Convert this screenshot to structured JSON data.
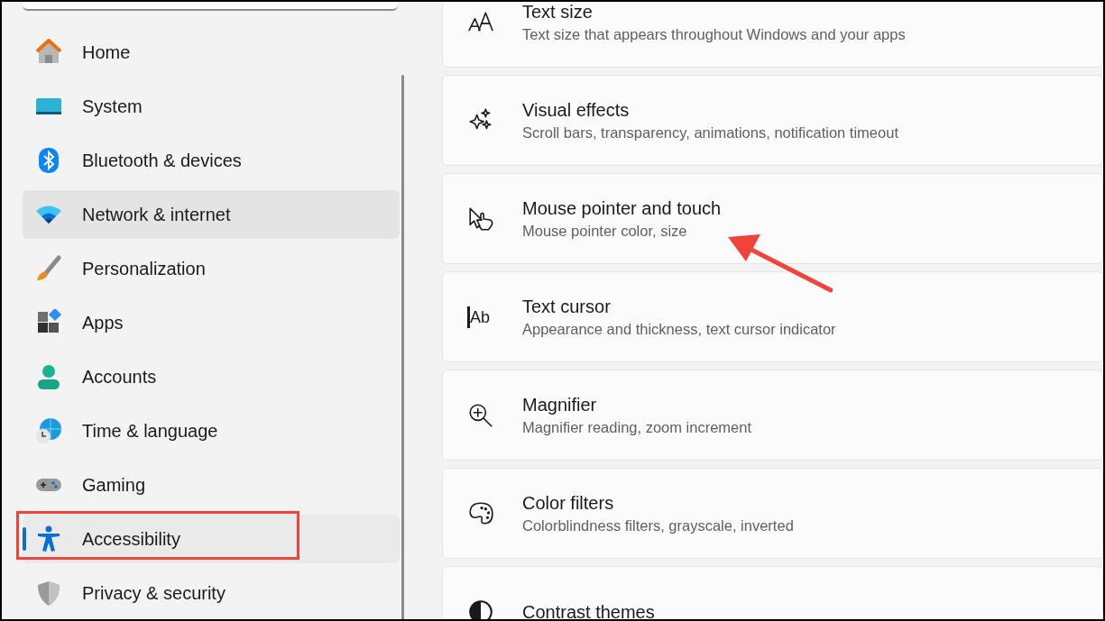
{
  "sidebar": {
    "items": [
      {
        "label": "Home",
        "selected": false,
        "hovered": false,
        "outlined": false
      },
      {
        "label": "System",
        "selected": false,
        "hovered": false,
        "outlined": false
      },
      {
        "label": "Bluetooth & devices",
        "selected": false,
        "hovered": false,
        "outlined": false
      },
      {
        "label": "Network & internet",
        "selected": false,
        "hovered": true,
        "outlined": false
      },
      {
        "label": "Personalization",
        "selected": false,
        "hovered": false,
        "outlined": false
      },
      {
        "label": "Apps",
        "selected": false,
        "hovered": false,
        "outlined": false
      },
      {
        "label": "Accounts",
        "selected": false,
        "hovered": false,
        "outlined": false
      },
      {
        "label": "Time & language",
        "selected": false,
        "hovered": false,
        "outlined": false
      },
      {
        "label": "Gaming",
        "selected": false,
        "hovered": false,
        "outlined": false
      },
      {
        "label": "Accessibility",
        "selected": true,
        "hovered": false,
        "outlined": true
      },
      {
        "label": "Privacy & security",
        "selected": false,
        "hovered": false,
        "outlined": false
      }
    ]
  },
  "settings": [
    {
      "title": "Text size",
      "subtitle": "Text size that appears throughout Windows and your apps",
      "arrow": false
    },
    {
      "title": "Visual effects",
      "subtitle": "Scroll bars, transparency, animations, notification timeout",
      "arrow": false
    },
    {
      "title": "Mouse pointer and touch",
      "subtitle": "Mouse pointer color, size",
      "arrow": true
    },
    {
      "title": "Text cursor",
      "subtitle": "Appearance and thickness, text cursor indicator",
      "arrow": false,
      "icon_text": "Ab"
    },
    {
      "title": "Magnifier",
      "subtitle": "Magnifier reading, zoom increment",
      "arrow": false
    },
    {
      "title": "Color filters",
      "subtitle": "Colorblindness filters, grayscale, inverted",
      "arrow": false
    },
    {
      "title": "Contrast themes",
      "arrow": false
    }
  ]
}
